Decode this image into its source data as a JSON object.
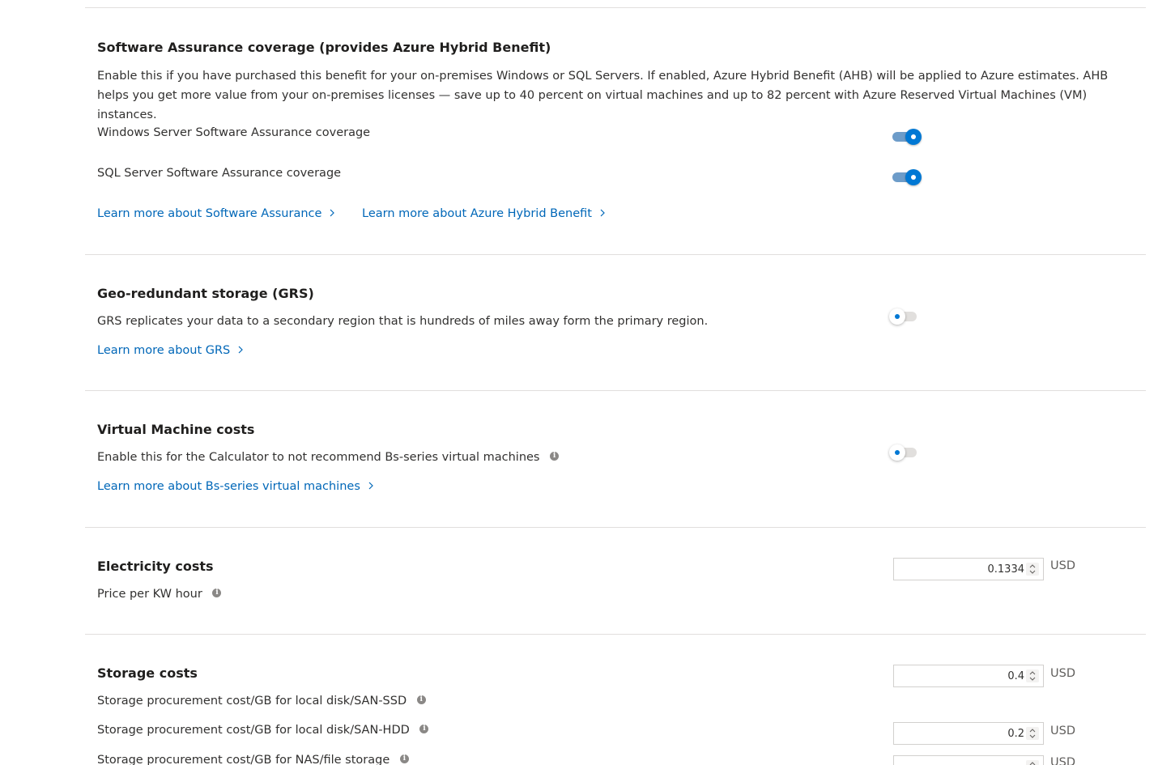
{
  "software_assurance": {
    "title": "Software Assurance coverage (provides Azure Hybrid Benefit)",
    "description": "Enable this if you have purchased this benefit for your on-premises Windows or SQL Servers. If enabled, Azure Hybrid Benefit (AHB) will be applied to Azure estimates. AHB helps you get more value from your on-premises licenses — save up to 40 percent on virtual machines and up to 82 percent with Azure Reserved Virtual Machines (VM) instances.",
    "windows_label": "Windows Server Software Assurance coverage",
    "windows_enabled": true,
    "sql_label": "SQL Server Software Assurance coverage",
    "sql_enabled": true,
    "link_sa": "Learn more about Software Assurance",
    "link_ahb": "Learn more about Azure Hybrid Benefit"
  },
  "grs": {
    "title": "Geo-redundant storage (GRS)",
    "description": "GRS replicates your data to a secondary region that is hundreds of miles away form the primary region.",
    "enabled": false,
    "link": "Learn more about GRS"
  },
  "vm_costs": {
    "title": "Virtual Machine costs",
    "description": "Enable this for the Calculator to not recommend Bs-series virtual machines",
    "enabled": false,
    "link": "Learn more about Bs-series virtual machines"
  },
  "electricity": {
    "title": "Electricity costs",
    "label": "Price per KW hour",
    "value": "0.1334",
    "unit": "USD"
  },
  "storage": {
    "title": "Storage costs",
    "ssd_label": "Storage procurement cost/GB for local disk/SAN-SSD",
    "ssd_value": "0.4",
    "hdd_label": "Storage procurement cost/GB for local disk/SAN-HDD",
    "hdd_value": "0.2",
    "nas_label": "Storage procurement cost/GB for NAS/file storage",
    "unit": "USD"
  },
  "colors": {
    "accent": "#0078d4",
    "link": "#0067b8",
    "divider": "#e1dfdd"
  }
}
